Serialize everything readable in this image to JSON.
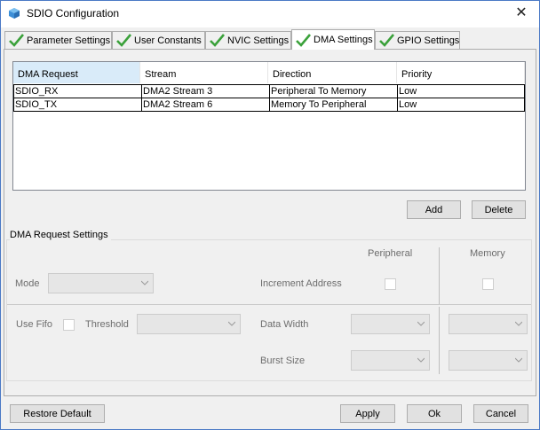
{
  "window": {
    "title": "SDIO Configuration",
    "close_glyph": "✕",
    "icon": "cube-icon",
    "accent": "#4a79c5"
  },
  "tabs": [
    {
      "label": "Parameter Settings",
      "active": false
    },
    {
      "label": "User Constants",
      "active": false
    },
    {
      "label": "NVIC Settings",
      "active": false
    },
    {
      "label": "DMA Settings",
      "active": true
    },
    {
      "label": "GPIO Settings",
      "active": false
    }
  ],
  "dma_table": {
    "columns": [
      "DMA Request",
      "Stream",
      "Direction",
      "Priority"
    ],
    "rows": [
      [
        "SDIO_RX",
        "DMA2 Stream 3",
        "Peripheral To Memory",
        "Low"
      ],
      [
        "SDIO_TX",
        "DMA2 Stream 6",
        "Memory To Peripheral",
        "Low"
      ]
    ]
  },
  "table_buttons": {
    "add": "Add",
    "delete": "Delete"
  },
  "request_settings": {
    "group_title": "DMA Request Settings",
    "mode_label": "Mode",
    "peripheral_label": "Peripheral",
    "memory_label": "Memory",
    "increment_label": "Increment Address",
    "use_fifo_label": "Use Fifo",
    "threshold_label": "Threshold",
    "data_width_label": "Data Width",
    "burst_size_label": "Burst Size"
  },
  "footer": {
    "restore_default": "Restore Default",
    "apply": "Apply",
    "ok": "Ok",
    "cancel": "Cancel"
  },
  "colors": {
    "check_green": "#3aa13a",
    "header_selected": "#d9ebf9"
  }
}
